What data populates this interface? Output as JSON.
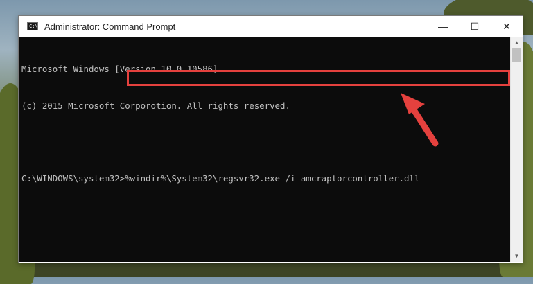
{
  "window": {
    "title": "Administrator: Command Prompt",
    "app_icon_text": "C:\\",
    "controls": {
      "minimize": "—",
      "maximize": "☐",
      "close": "✕"
    }
  },
  "console": {
    "lines": [
      "Microsoft Windows [Version 10.0.10586]",
      "(c) 2015 Microsoft Corporotion. All rights reserved.",
      "",
      "C:\\WINDOWS\\system32>%windir%\\System32\\regsvr32.exe /i amcraptorcontroller.dll"
    ]
  },
  "scrollbar": {
    "up": "▲",
    "down": "▼"
  },
  "colors": {
    "highlight": "#e5413e",
    "console_bg": "#0c0c0c",
    "console_text": "#c0c0c0"
  }
}
